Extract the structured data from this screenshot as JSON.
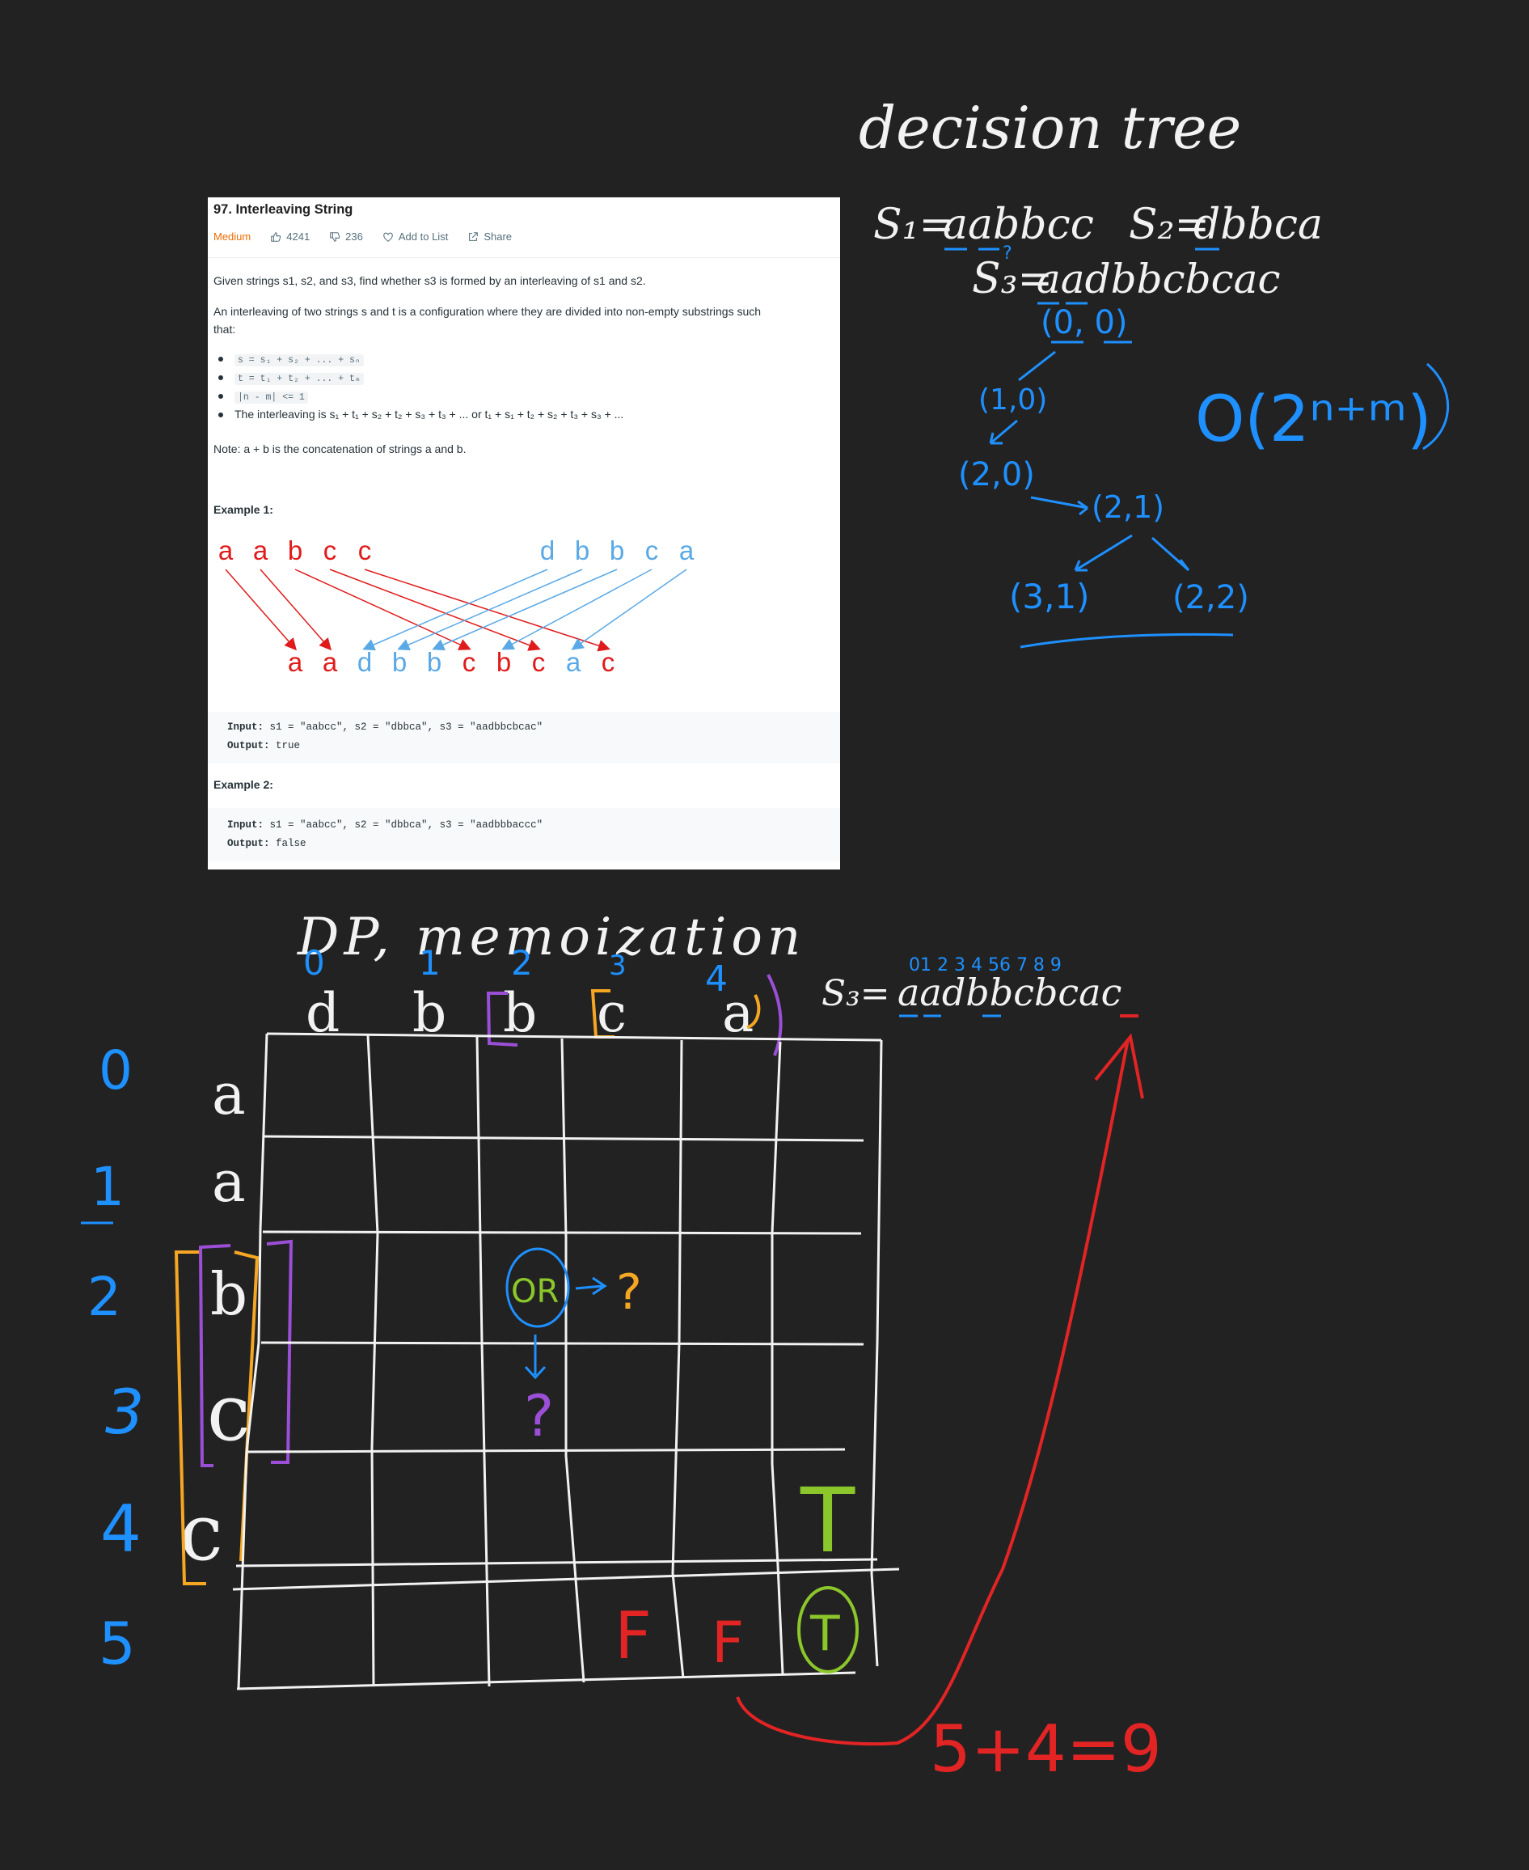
{
  "notes": {
    "decision_tree_title": "decision tree",
    "s1_label": "S₁=",
    "s1_value": "aabbcc",
    "s2_label": "S₂=",
    "s2_value": "dbbca",
    "s3_label": "S₃=",
    "s3_value": "aadbbcbcac",
    "tree_nodes": [
      "(0, 0)",
      "(1,0)",
      "(2,0)",
      "(2,1)",
      "(3,1)",
      "(2,2)"
    ],
    "complexity": "O(2ⁿ⁺ᵐ)",
    "dp_title": "DP, memoization",
    "s3_index_digits": "01 2 3 4 56 7 8 9",
    "col_indices": [
      "0",
      "1",
      "2",
      "3",
      "4"
    ],
    "col_letters": [
      "d",
      "b",
      "b",
      "c",
      "a"
    ],
    "row_indices": [
      "0",
      "1",
      "2",
      "3",
      "4",
      "5"
    ],
    "row_letters": [
      "a",
      "a",
      "b",
      "c",
      "c"
    ],
    "cell_or": "OR",
    "question_mark": "?",
    "cell_T": "T",
    "cell_F": "F",
    "sum_note": "5+4=9",
    "colors": {
      "blue": "#1e90ff",
      "red": "#e32424",
      "white": "#f2f2f2",
      "orange": "#f5a623",
      "purple": "#9b4fd6",
      "green": "#8bc72a"
    }
  },
  "problem": {
    "title": "97. Interleaving String",
    "difficulty": "Medium",
    "likes": "4241",
    "dislikes": "236",
    "add_to_list": "Add to List",
    "share": "Share",
    "desc_1": "Given strings s1, s2, and s3, find whether s3 is formed by an interleaving of s1 and s2.",
    "desc_2a": "An interleaving of two strings s and t is a configuration where they are divided into non-empty substrings such",
    "desc_2b": "that:",
    "bullets": [
      "s = s₁ + s₂ + ... + sₙ",
      "t = t₁ + t₂ + ... + tₘ",
      "|n - m| <= 1",
      "The interleaving is s₁ + t₁ + s₂ + t₂ + s₃ + t₃ + ... or t₁ + s₁ + t₂ + s₂ + t₃ + s₃ + ..."
    ],
    "note": "Note: a + b is the concatenation of strings a and b.",
    "example1_heading": "Example 1:",
    "example1_s1_letters": [
      "a",
      "a",
      "b",
      "c",
      "c"
    ],
    "example1_s2_letters": [
      "d",
      "b",
      "b",
      "c",
      "a"
    ],
    "example1_s3_letters": [
      "a",
      "a",
      "d",
      "b",
      "b",
      "c",
      "b",
      "c",
      "a",
      "c"
    ],
    "example1_input_label": "Input:",
    "example1_input": "s1 = \"aabcc\", s2 = \"dbbca\", s3 = \"aadbbcbcac\"",
    "example1_output_label": "Output:",
    "example1_output": "true",
    "example2_heading": "Example 2:",
    "example2_input_label": "Input:",
    "example2_input": "s1 = \"aabcc\", s2 = \"dbbca\", s3 = \"aadbbbaccc\"",
    "example2_output_label": "Output:",
    "example2_output": "false",
    "colors": {
      "s1": "#e01b1b",
      "s2": "#5aa9e6"
    }
  }
}
